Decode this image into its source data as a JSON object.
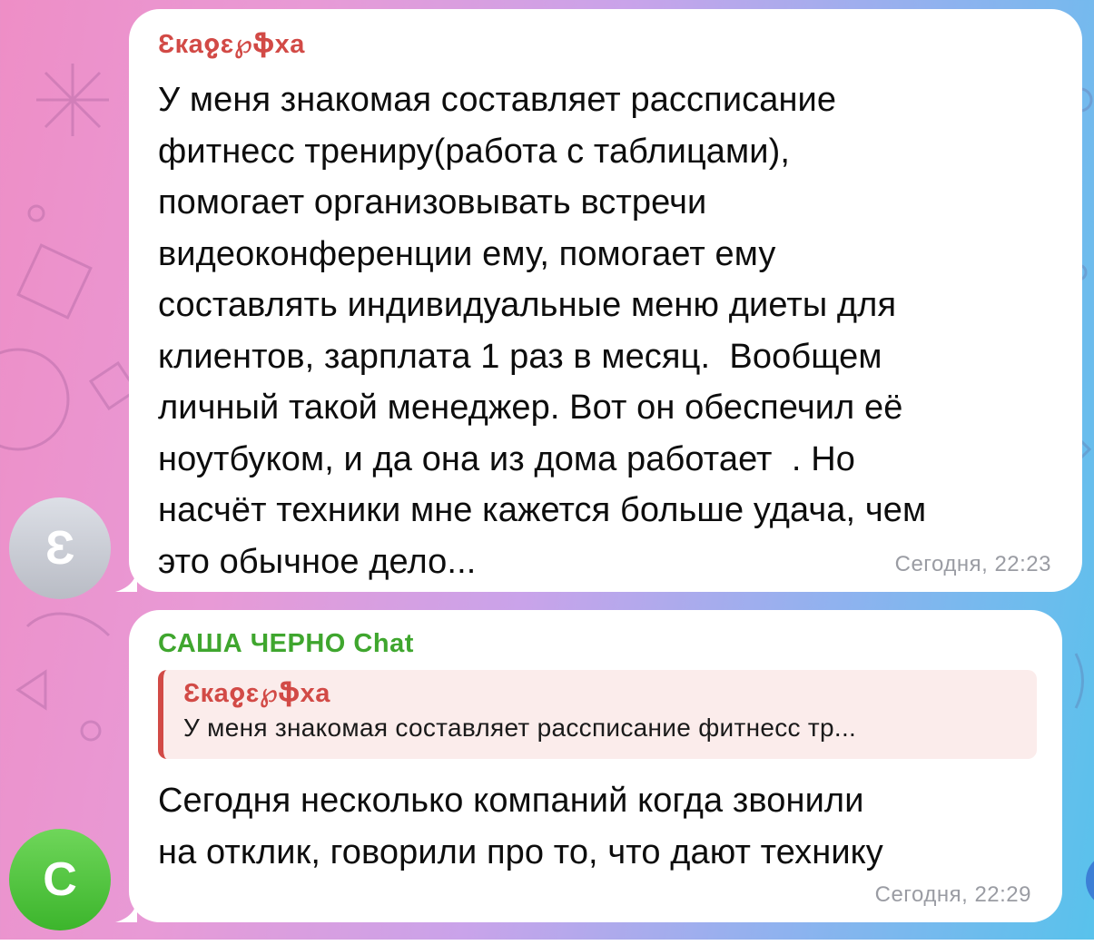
{
  "messages": [
    {
      "sender": "Ɛкаჹɛ℘ֆха",
      "avatar_letter": "Ɛ",
      "text": "У меня знакомая составляет рассписание\nфитнесс трениру(работа с таблицами),\nпомогает организовывать встречи\nвидеоконференции ему, помогает ему\nсоставлять индивидуальные меню диеты для\nклиентов, зарплата 1 раз в месяц.  Вообщем\nличный такой менеджер. Вот он обеспечил её\nноутбуком, и да она из дома работает  . Но\nнасчёт техники мне кажется больше удача, чем\nэто обычное дело...",
      "time": "Сегодня, 22:23"
    },
    {
      "sender": "САША ЧЕРНО Chat",
      "avatar_letter": "С",
      "reply": {
        "sender": "Ɛкаჹɛ℘ֆха",
        "text": "У меня знакомая составляет рассписание фитнесс тр..."
      },
      "text": "Сегодня несколько компаний когда звонили\nна отклик, говорили про то, что дают технику",
      "time": "Сегодня, 22:29"
    }
  ],
  "colors": {
    "sender_1": "#d24a46",
    "sender_2": "#3fa62e",
    "avatar_1": "#c9ccd3",
    "avatar_2": "#4cc13a",
    "time": "#9a9ca3"
  }
}
